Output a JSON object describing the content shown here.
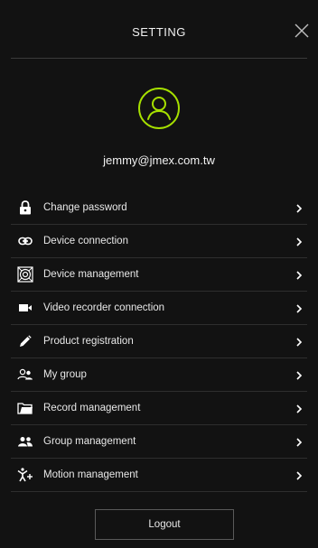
{
  "header": {
    "title": "SETTING",
    "close_icon": "close-icon"
  },
  "profile": {
    "avatar_icon": "user-avatar-icon",
    "avatar_color": "#a6e000",
    "email": "jemmy@jmex.com.tw"
  },
  "menu": {
    "items": [
      {
        "label": "Change password",
        "icon": "lock-icon"
      },
      {
        "label": "Device connection",
        "icon": "link-icon"
      },
      {
        "label": "Device management",
        "icon": "device-manage-icon"
      },
      {
        "label": "Video recorder connection",
        "icon": "video-camera-icon"
      },
      {
        "label": "Product registration",
        "icon": "pencil-icon"
      },
      {
        "label": "My group",
        "icon": "my-group-icon"
      },
      {
        "label": "Record management",
        "icon": "folder-icon"
      },
      {
        "label": "Group management",
        "icon": "group-icon"
      },
      {
        "label": "Motion management",
        "icon": "motion-icon"
      }
    ]
  },
  "footer": {
    "logout_label": "Logout"
  }
}
